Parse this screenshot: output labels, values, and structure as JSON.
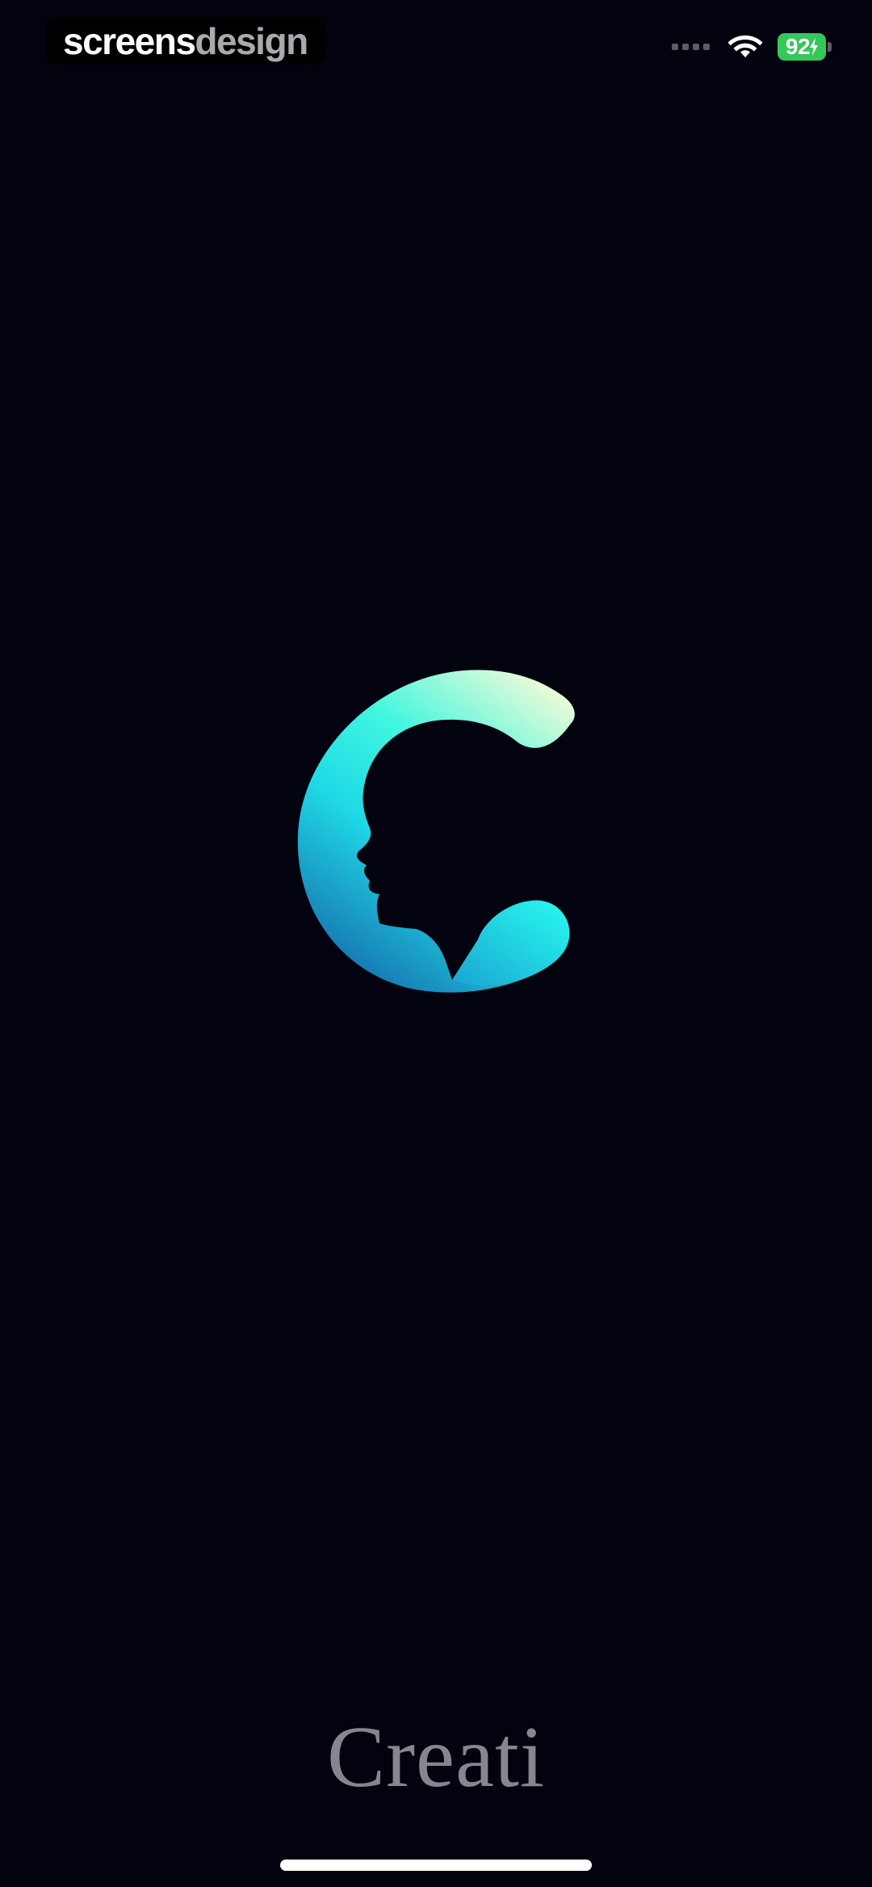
{
  "watermark": {
    "part1": "screens",
    "part2": "design"
  },
  "status_bar": {
    "battery_level": "92",
    "battery_color": "#34c759",
    "wifi_icon": "wifi-icon",
    "charging": true
  },
  "logo": {
    "icon": "c-face-logo-icon",
    "gradient_colors": [
      "#e9fbd8",
      "#22f2e6",
      "#1a7fb8"
    ]
  },
  "brand": {
    "name": "Creati"
  },
  "colors": {
    "background": "#03030f",
    "brand_text": "#86868f"
  }
}
